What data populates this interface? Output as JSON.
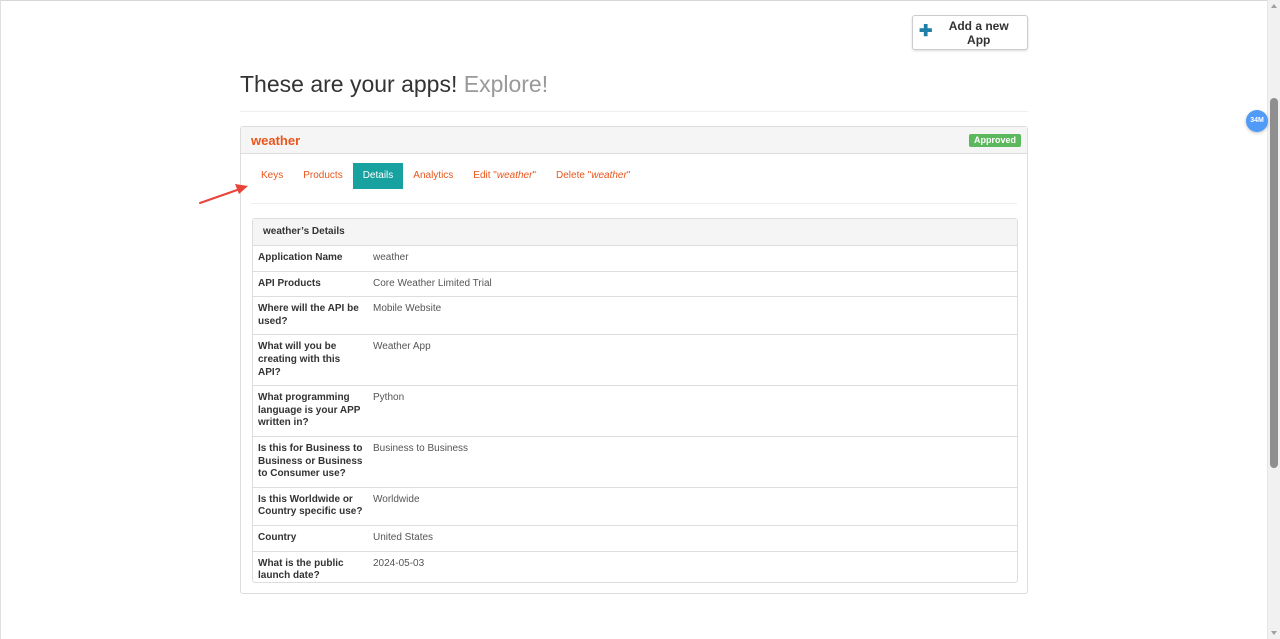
{
  "toolbar": {
    "add_app_label": "Add a new App"
  },
  "floating_badge": "34M",
  "page": {
    "title": "These are your apps!",
    "title_accent": "Explore!"
  },
  "app": {
    "name": "weather",
    "status": "Approved",
    "status_color": "#5cb85c",
    "accent_color": "#e8561c",
    "active_tab_color": "#17a2a0"
  },
  "tabs": {
    "keys": "Keys",
    "products": "Products",
    "details": "Details",
    "analytics": "Analytics",
    "edit_prefix": "Edit \"",
    "edit_name": "weather",
    "edit_suffix": "\"",
    "delete_prefix": "Delete \"",
    "delete_name": "weather",
    "delete_suffix": "\""
  },
  "details": {
    "heading": "weather’s Details",
    "rows": [
      {
        "label": "Application Name",
        "value": "weather"
      },
      {
        "label": "API Products",
        "value": "Core Weather Limited Trial"
      },
      {
        "label": "Where will the API be used?",
        "value": "Mobile Website"
      },
      {
        "label": "What will you be creating with this API?",
        "value": "Weather App"
      },
      {
        "label": "What programming language is your APP written in?",
        "value": "Python"
      },
      {
        "label": "Is this for Business to Business or Business to Consumer use?",
        "value": "Business to Business"
      },
      {
        "label": "Is this Worldwide or Country specific use?",
        "value": "Worldwide"
      },
      {
        "label": "Country",
        "value": "United States"
      },
      {
        "label": "What is the public launch date?",
        "value": "2024-05-03"
      }
    ]
  }
}
